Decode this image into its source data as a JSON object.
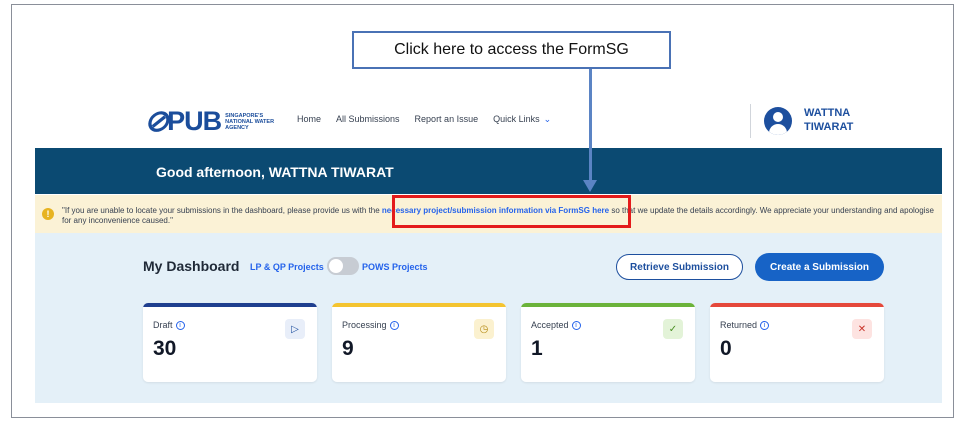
{
  "callout": {
    "text": "Click here to access the FormSG"
  },
  "header": {
    "logo_mark": "⊘",
    "logo_word": "PUB",
    "logo_sub": "SINGAPORE'S NATIONAL WATER AGENCY",
    "nav": [
      "Home",
      "All Submissions",
      "Report an Issue",
      "Quick Links"
    ],
    "user_name": "WATTNA TIWARAT"
  },
  "greeting": "Good afternoon, WATTNA TIWARAT",
  "notice": {
    "before": "\"If you are unable to locate your submissions in the dashboard, please provide us with the ",
    "link": "necessary project/submission information via FormSG here",
    "after": " so that we update the details accordingly. We appreciate your understanding and apologise for any inconvenience caused.\""
  },
  "dashboard": {
    "title": "My Dashboard",
    "tab_left": "LP & QP Projects",
    "tab_right": "POWS Projects",
    "retrieve_label": "Retrieve Submission",
    "create_label": "Create a Submission"
  },
  "cards": [
    {
      "label": "Draft",
      "count": "30",
      "icon": "draft-icon",
      "color": "#1f3f8f",
      "badge_bg": "#e8eef9",
      "badge_fg": "#1d4f9e"
    },
    {
      "label": "Processing",
      "count": "9",
      "icon": "clock-icon",
      "color": "#f4c430",
      "badge_bg": "#fbf1cf",
      "badge_fg": "#b48a12"
    },
    {
      "label": "Accepted",
      "count": "1",
      "icon": "check-circle-icon",
      "color": "#6bb33a",
      "badge_bg": "#e3f3d8",
      "badge_fg": "#4a8f23"
    },
    {
      "label": "Returned",
      "count": "0",
      "icon": "x-circle-icon",
      "color": "#e5483b",
      "badge_bg": "#fde3e1",
      "badge_fg": "#c9342a"
    }
  ]
}
